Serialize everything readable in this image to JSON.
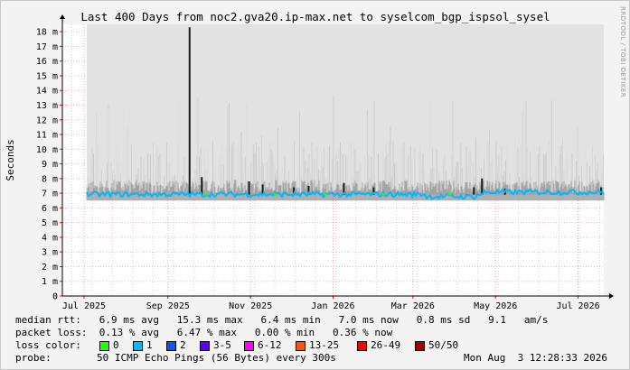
{
  "chart_data": {
    "type": "area",
    "title": "Last 400 Days from noc2.gva20.ip-max.net to syselcom_bgp_ispsol_sysel",
    "ylabel": "Seconds",
    "ylim": [
      0,
      0.0185
    ],
    "y_ticks": [
      {
        "v": 0,
        "label": "0"
      },
      {
        "v": 0.001,
        "label": "1 m"
      },
      {
        "v": 0.002,
        "label": "2 m"
      },
      {
        "v": 0.003,
        "label": "3 m"
      },
      {
        "v": 0.004,
        "label": "4 m"
      },
      {
        "v": 0.005,
        "label": "5 m"
      },
      {
        "v": 0.006,
        "label": "6 m"
      },
      {
        "v": 0.007,
        "label": "7 m"
      },
      {
        "v": 0.008,
        "label": "8 m"
      },
      {
        "v": 0.009,
        "label": "9 m"
      },
      {
        "v": 0.01,
        "label": "10 m"
      },
      {
        "v": 0.011,
        "label": "11 m"
      },
      {
        "v": 0.012,
        "label": "12 m"
      },
      {
        "v": 0.013,
        "label": "13 m"
      },
      {
        "v": 0.014,
        "label": "14 m"
      },
      {
        "v": 0.015,
        "label": "15 m"
      },
      {
        "v": 0.016,
        "label": "16 m"
      },
      {
        "v": 0.017,
        "label": "17 m"
      },
      {
        "v": 0.018,
        "label": "18 m"
      }
    ],
    "x_range": [
      "2025-06-29",
      "2026-08-03"
    ],
    "data_start": "2025-07-17",
    "x_ticks": [
      {
        "date": "2025-07-15",
        "label": "Jul 2025"
      },
      {
        "date": "2025-09-15",
        "label": "Sep 2025"
      },
      {
        "date": "2025-11-15",
        "label": "Nov 2025"
      },
      {
        "date": "2026-01-15",
        "label": "Jan 2026"
      },
      {
        "date": "2026-03-15",
        "label": "Mar 2026"
      },
      {
        "date": "2026-05-15",
        "label": "May 2026"
      },
      {
        "date": "2026-07-15",
        "label": "Jul 2026"
      }
    ],
    "grid": true,
    "series": [
      {
        "name": "median rtt",
        "values_ms_typical": 6.9,
        "values_ms_min": 6.4,
        "values_ms_max": 15.3
      },
      {
        "name": "smoke",
        "values_ms_range": [
          6.4,
          18.3
        ]
      }
    ],
    "spikes": [
      {
        "date": "2025-10-01",
        "value_ms": 18.3
      },
      {
        "date": "2025-10-10",
        "value_ms": 8.1
      },
      {
        "date": "2025-11-14",
        "value_ms": 7.8
      },
      {
        "date": "2025-11-24",
        "value_ms": 7.6
      },
      {
        "date": "2025-12-17",
        "value_ms": 7.4
      },
      {
        "date": "2025-12-28",
        "value_ms": 7.5
      },
      {
        "date": "2026-01-23",
        "value_ms": 7.7
      },
      {
        "date": "2026-02-14",
        "value_ms": 7.4
      },
      {
        "date": "2026-04-29",
        "value_ms": 7.4
      },
      {
        "date": "2026-05-05",
        "value_ms": 8.0
      },
      {
        "date": "2026-05-22",
        "value_ms": 7.3
      },
      {
        "date": "2026-08-01",
        "value_ms": 7.4
      }
    ]
  },
  "stats": {
    "median_rtt": "median rtt:   6.9 ms avg   15.3 ms max   6.4 ms min   7.0 ms now   0.8 ms sd   9.1   am/s",
    "packet_loss": "packet loss:  0.13 % avg   6.47 % max   0.00 % min   0.36 % now"
  },
  "loss_color": {
    "label": "loss color:",
    "items": [
      {
        "label": "0",
        "color": "#26ff00"
      },
      {
        "label": "1",
        "color": "#00b8ff"
      },
      {
        "label": "2",
        "color": "#0059ff"
      },
      {
        "label": "3-5",
        "color": "#5e00ff"
      },
      {
        "label": "6-12",
        "color": "#ff00ff"
      },
      {
        "label": "13-25",
        "color": "#ff5500"
      },
      {
        "label": "26-49",
        "color": "#ff0000"
      },
      {
        "label": "50/50",
        "color": "#a10000"
      }
    ]
  },
  "probe": {
    "label": "probe:",
    "value": "50 ICMP Echo Pings (56 Bytes) every 300s",
    "timestamp": "Mon Aug  3 12:28:33 2026"
  },
  "watermark": "RRDTOOL / TOBI OETIKER"
}
